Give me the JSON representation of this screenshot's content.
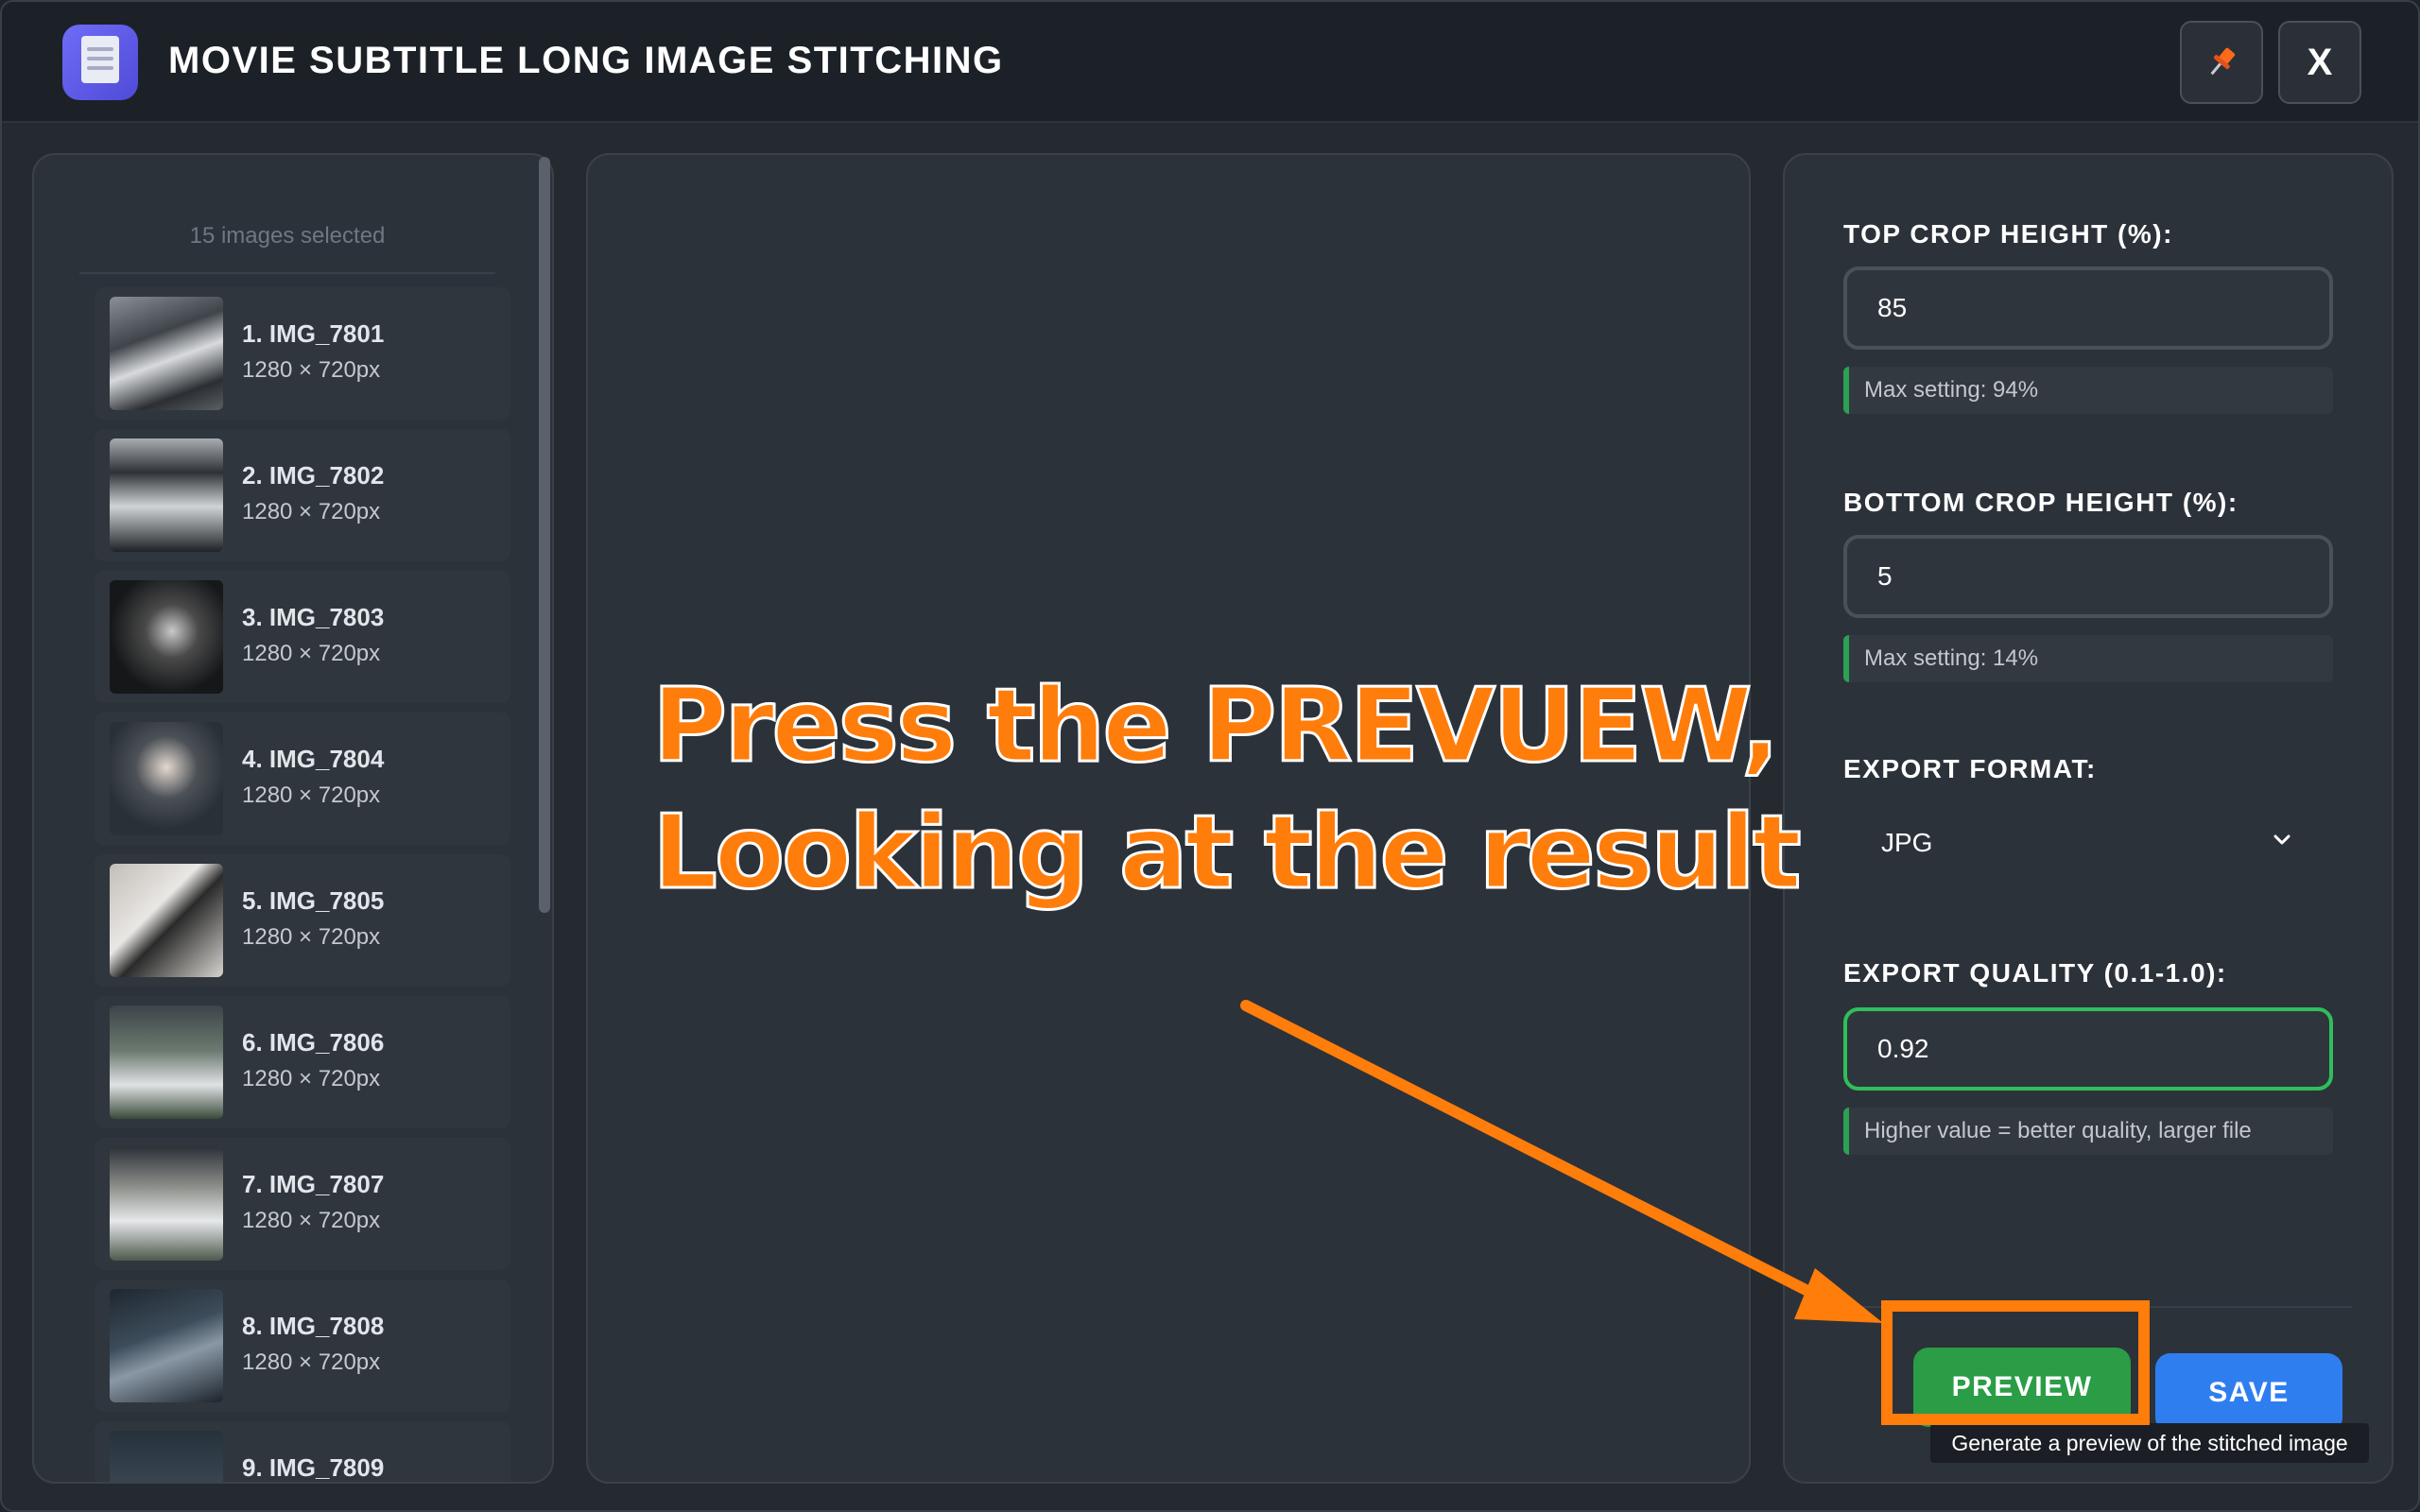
{
  "window": {
    "title": "MOVIE SUBTITLE LONG IMAGE STITCHING",
    "close_label": "X"
  },
  "sidebar": {
    "count_label": "15 images selected",
    "items": [
      {
        "name": "1. IMG_7801",
        "size": "1280 × 720px"
      },
      {
        "name": "2. IMG_7802",
        "size": "1280 × 720px"
      },
      {
        "name": "3. IMG_7803",
        "size": "1280 × 720px"
      },
      {
        "name": "4. IMG_7804",
        "size": "1280 × 720px"
      },
      {
        "name": "5. IMG_7805",
        "size": "1280 × 720px"
      },
      {
        "name": "6. IMG_7806",
        "size": "1280 × 720px"
      },
      {
        "name": "7. IMG_7807",
        "size": "1280 × 720px"
      },
      {
        "name": "8. IMG_7808",
        "size": "1280 × 720px"
      },
      {
        "name": "9. IMG_7809",
        "size": ""
      }
    ]
  },
  "annotation": {
    "line1": "Press the PREVUEW,",
    "line2": "Looking at the result"
  },
  "settings": {
    "top_crop": {
      "label": "TOP CROP HEIGHT (%):",
      "value": "85",
      "hint": "Max setting: 94%"
    },
    "bottom_crop": {
      "label": "BOTTOM CROP HEIGHT (%):",
      "value": "5",
      "hint": "Max setting: 14%"
    },
    "format": {
      "label": "EXPORT FORMAT:",
      "value": "JPG"
    },
    "quality": {
      "label": "EXPORT QUALITY (0.1-1.0):",
      "value": "0.92",
      "hint": "Higher value = better quality, larger file"
    },
    "preview_label": "PREVIEW",
    "save_label": "SAVE",
    "preview_tooltip": "Generate a preview of the stitched image"
  },
  "colors": {
    "accent_orange": "#ff7d0b",
    "preview_green": "#2a9d46",
    "save_blue": "#2f7ef0",
    "active_border": "#2fbf5a"
  }
}
